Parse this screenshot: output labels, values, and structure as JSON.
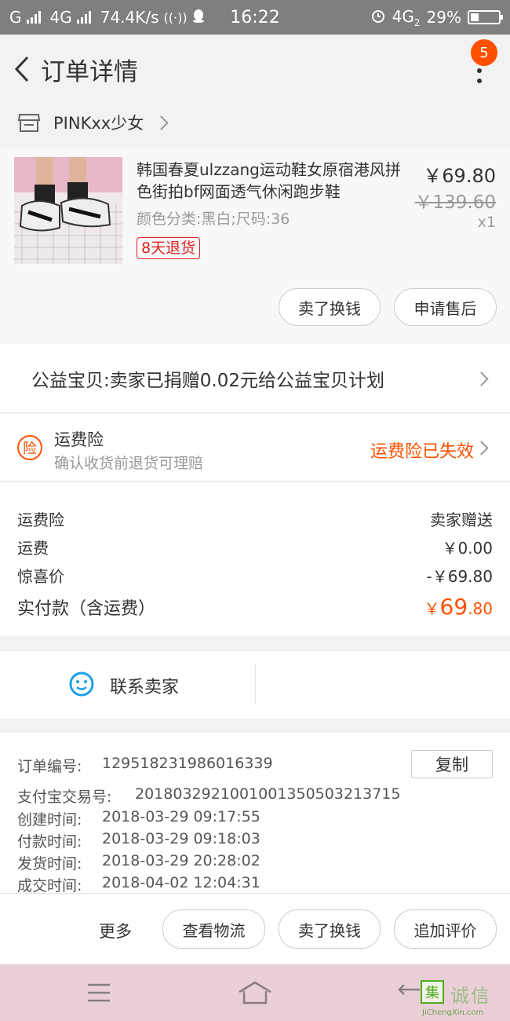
{
  "status_bar": {
    "carrier1": "G",
    "carrier2": "4G",
    "net_speed": "74.4K/s",
    "time": "16:22",
    "network": "4G",
    "network_sub": "2",
    "battery": "29%",
    "battery_level": 0.29
  },
  "header": {
    "title": "订单详情",
    "badge_count": "5"
  },
  "store": {
    "name": "PINKxx少女"
  },
  "item": {
    "title": "韩国春夏ulzzang运动鞋女原宿港风拼色街拍bf网面透气休闲跑步鞋",
    "sku": "颜色分类:黑白;尺码:36",
    "tag": "8天退货",
    "price": "￥69.80",
    "original_price": "￥139.60",
    "quantity": "x1",
    "buttons": {
      "sell": "卖了换钱",
      "after_sale": "申请售后"
    }
  },
  "charity": {
    "text": "公益宝贝:卖家已捐赠0.02元给公益宝贝计划"
  },
  "insurance": {
    "icon_char": "险",
    "title": "运费险",
    "subtitle": "确认收货前退货可理赔",
    "status": "运费险已失效"
  },
  "fees": [
    {
      "label": "运费险",
      "value": "卖家赠送"
    },
    {
      "label": "运费",
      "value": "￥0.00"
    },
    {
      "label": "惊喜价",
      "value": "-￥69.80"
    }
  ],
  "total": {
    "label": "实付款（含运费）",
    "currency": "￥",
    "integer": "69",
    "decimal": ".80"
  },
  "contact": {
    "label": "联系卖家"
  },
  "order_info": {
    "copy_label": "复制",
    "rows": [
      {
        "key": "订单编号:",
        "value": "129518231986016339"
      },
      {
        "key": "支付宝交易号:",
        "value": "2018032921001001350503213715"
      },
      {
        "key": "创建时间:",
        "value": "2018-03-29 09:17:55"
      },
      {
        "key": "付款时间:",
        "value": "2018-03-29 09:18:03"
      },
      {
        "key": "发货时间:",
        "value": "2018-03-29 20:28:02"
      },
      {
        "key": "成交时间:",
        "value": "2018-04-02 12:04:31"
      }
    ]
  },
  "actions": {
    "more": "更多",
    "logistics": "查看物流",
    "sell": "卖了换钱",
    "review": "追加评价"
  },
  "watermark": {
    "mark": "集",
    "text": "诚信",
    "sub": "JiChengXin.com"
  },
  "colors": {
    "accent": "#ff5000",
    "tag_red": "#dd2222",
    "contact_blue": "#1fa0e8"
  }
}
